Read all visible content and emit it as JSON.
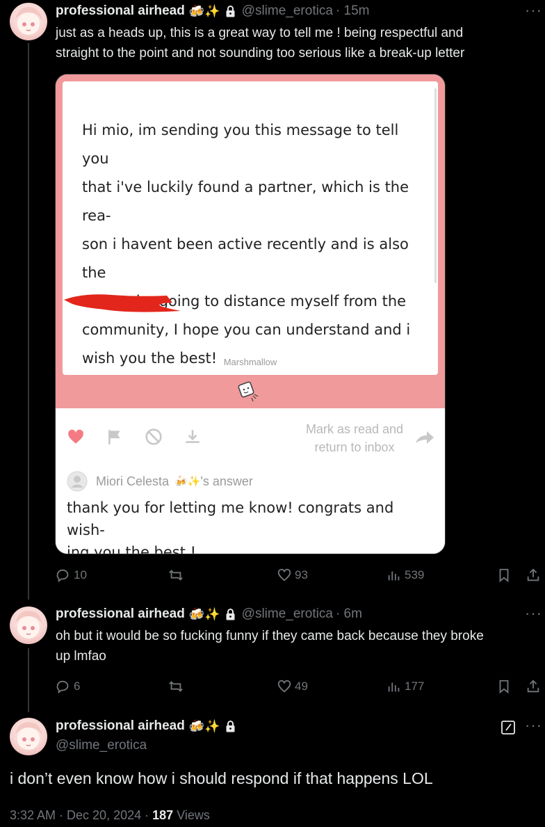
{
  "tweet1": {
    "name": "professional airhead",
    "emoji": "🍻✨",
    "handle": "@slime_erotica",
    "time": "· 15m",
    "text_line1": "just as a heads up, this is a great way to tell me ! being respectful and",
    "text_line2": "straight to the point and not sounding too serious like a break-up letter",
    "card": {
      "message_lines": [
        "Hi mio, im sending you this message to tell you",
        "that i've luckily found a partner, which is the rea-",
        "son i havent been active recently and is also the",
        "reason im going to distance myself from the",
        "community, I hope you can understand and i",
        "wish you the best!"
      ],
      "brand": "Marshmallow",
      "mark_read_line1": "Mark as read and",
      "mark_read_line2": "return to inbox",
      "answerer": "Miori Celesta",
      "answerer_emoji": "🍻✨",
      "answer_suffix": "'s answer",
      "answer_line1": "thank you for letting me know! congrats and wish-",
      "answer_line2": "ing you the best !"
    },
    "stats": {
      "replies": "10",
      "likes": "93",
      "views": "539"
    }
  },
  "tweet2": {
    "name": "professional airhead",
    "emoji": "🍻✨",
    "handle": "@slime_erotica",
    "time": "· 6m",
    "text_line1": "oh but it would be so fucking funny if they came back because they broke",
    "text_line2": "up lmfao",
    "stats": {
      "replies": "6",
      "likes": "49",
      "views": "177"
    }
  },
  "tweet3": {
    "name": "professional airhead",
    "emoji": "🍻✨",
    "handle": "@slime_erotica",
    "text": "i don’t even know how i should respond if that happens LOL",
    "timestamp": "3:32 AM · Dec 20, 2024 ·",
    "views_count": "187",
    "views_label": "Views"
  },
  "colors": {
    "marshmallow_pink": "#f09a9c",
    "heart": "#f47b83",
    "redaction": "#e3261b",
    "muted": "#71767b"
  },
  "icons": [
    "more-dots-icon",
    "lock-icon",
    "reply-icon",
    "retweet-icon",
    "like-icon",
    "views-icon",
    "bookmark-icon",
    "share-icon",
    "heart-icon",
    "flag-icon",
    "block-icon",
    "download-icon",
    "forward-arrow-icon",
    "edit-icon",
    "marshmallow-icon"
  ]
}
